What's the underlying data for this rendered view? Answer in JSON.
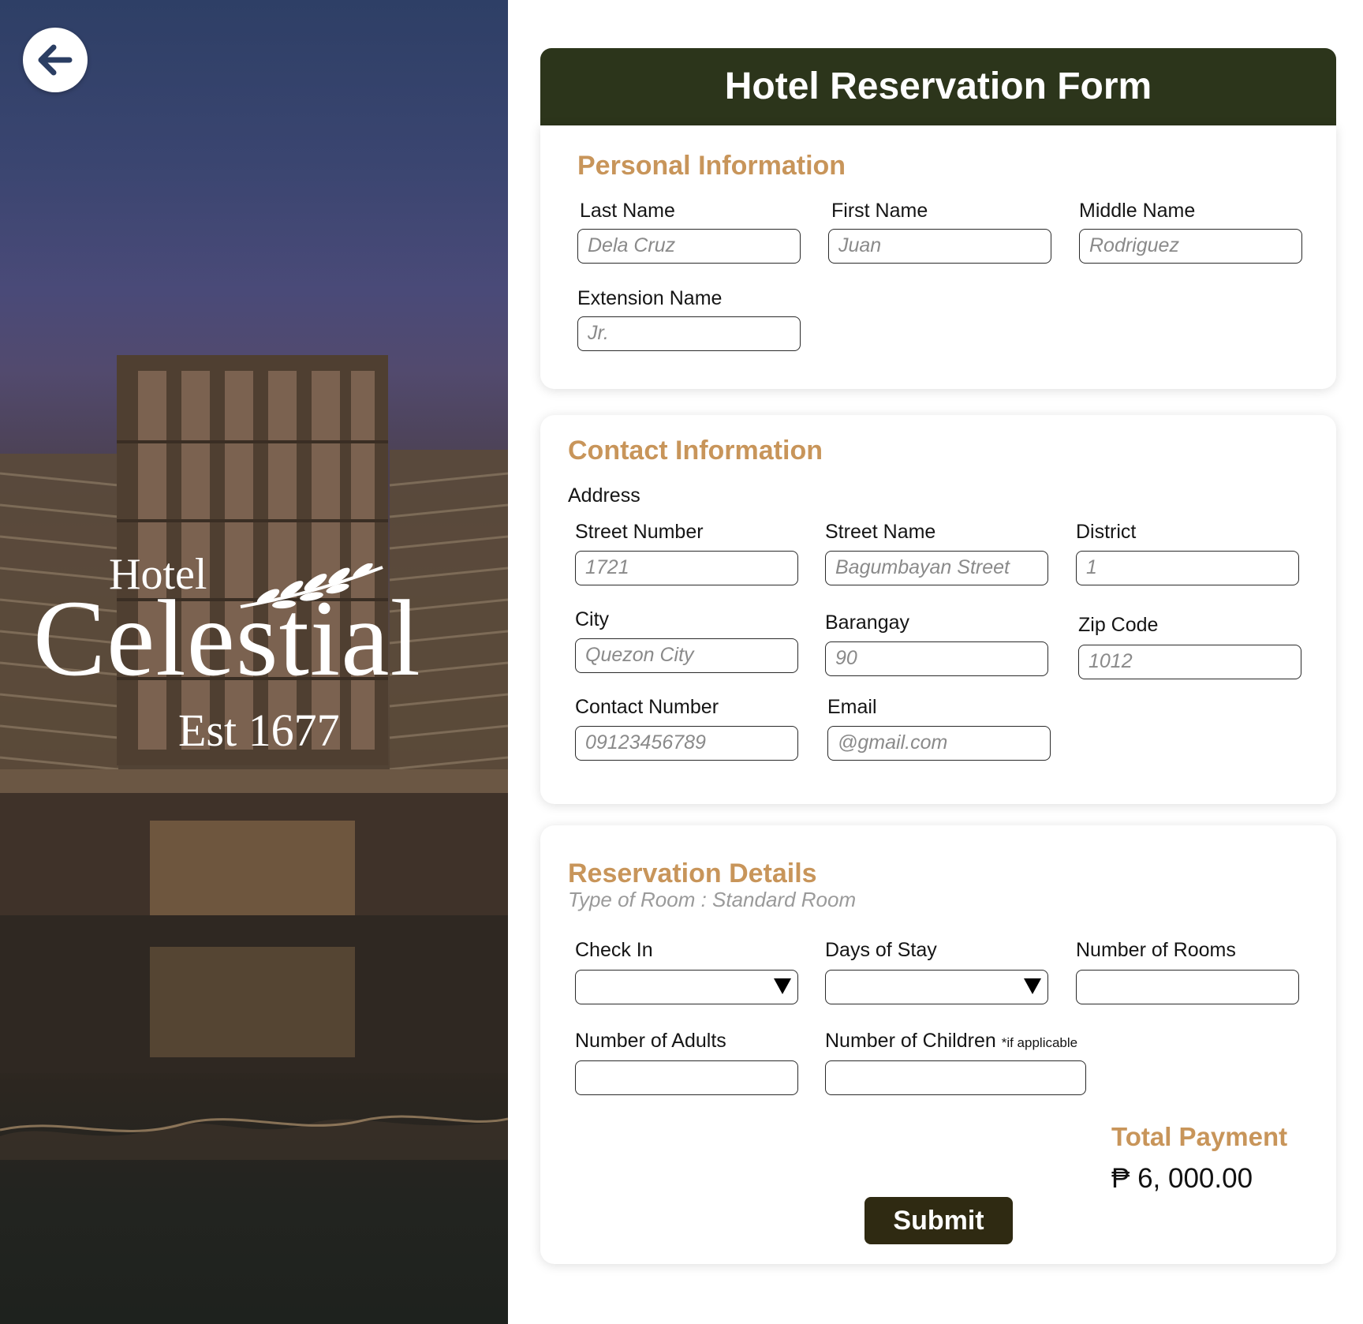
{
  "logo": {
    "hotel": "Hotel",
    "name": "Celestial",
    "established": "Est 1677"
  },
  "form": {
    "title": "Hotel Reservation Form",
    "personal": {
      "title": "Personal Information",
      "last_name": {
        "label": "Last Name",
        "placeholder": "Dela Cruz"
      },
      "first_name": {
        "label": "First Name",
        "placeholder": "Juan"
      },
      "middle_name": {
        "label": "Middle Name",
        "placeholder": "Rodriguez"
      },
      "extension_name": {
        "label": "Extension Name",
        "placeholder": "Jr."
      }
    },
    "contact": {
      "title": "Contact Information",
      "address_label": "Address",
      "street_number": {
        "label": "Street Number",
        "placeholder": "1721"
      },
      "street_name": {
        "label": "Street Name",
        "placeholder": "Bagumbayan Street"
      },
      "district": {
        "label": "District",
        "placeholder": "1"
      },
      "city": {
        "label": "City",
        "placeholder": "Quezon City"
      },
      "barangay": {
        "label": "Barangay",
        "placeholder": "90"
      },
      "zip_code": {
        "label": "Zip Code",
        "placeholder": "1012"
      },
      "contact_number": {
        "label": "Contact Number",
        "placeholder": "09123456789"
      },
      "email": {
        "label": "Email",
        "placeholder": "@gmail.com"
      }
    },
    "reservation": {
      "title": "Reservation Details",
      "room_type": "Type of Room : Standard Room",
      "check_in": {
        "label": "Check In",
        "value": ""
      },
      "days_of_stay": {
        "label": "Days of Stay",
        "value": ""
      },
      "number_of_rooms": {
        "label": "Number of Rooms",
        "value": ""
      },
      "number_of_adults": {
        "label": "Number of Adults",
        "value": ""
      },
      "number_of_children": {
        "label": "Number of Children",
        "note": "*if applicable",
        "value": ""
      },
      "total_payment_label": "Total Payment",
      "total_payment_amount": "₱ 6, 000.00"
    },
    "submit_label": "Submit"
  },
  "colors": {
    "header_bg": "#2c351b",
    "section_title": "#c8955a",
    "submit_bg": "#2f2a12"
  }
}
